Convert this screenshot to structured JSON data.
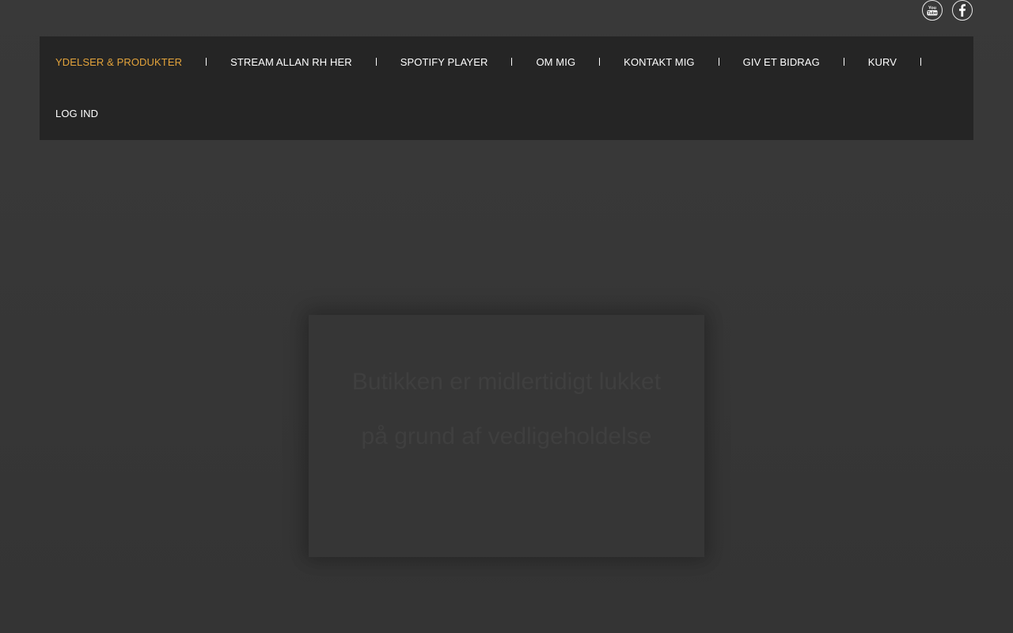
{
  "social": {
    "youtube_text": "You Tube",
    "facebook_icon": "facebook-icon"
  },
  "nav": {
    "items": [
      {
        "label": "YDELSER & PRODUKTER",
        "active": true
      },
      {
        "label": "STREAM ALLAN RH HER",
        "active": false
      },
      {
        "label": "SPOTIFY PLAYER",
        "active": false
      },
      {
        "label": "OM MIG",
        "active": false
      },
      {
        "label": "KONTAKT MIG",
        "active": false
      },
      {
        "label": "GIV ET BIDRAG",
        "active": false
      },
      {
        "label": "KURV",
        "active": false
      },
      {
        "label": "LOG IND",
        "active": false
      }
    ]
  },
  "notice": {
    "message": "Butikken er midlertidigt lukket på grund af vedligeholdelse"
  },
  "colors": {
    "accent": "#e3a33b",
    "nav_bg": "#252525",
    "page_bg": "#363636"
  }
}
